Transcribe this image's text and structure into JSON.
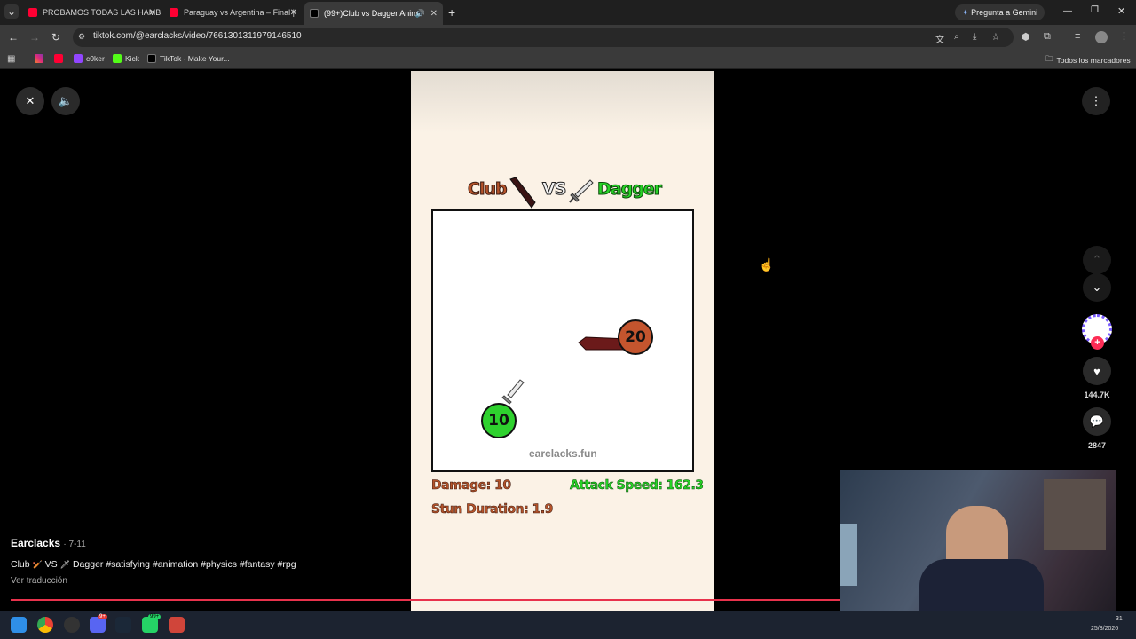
{
  "browser": {
    "tabs": [
      {
        "title": "PROBAMOS TODAS LAS HAMB",
        "favicon": "youtube-icon"
      },
      {
        "title": "Paraguay vs Argentina – Final |",
        "favicon": "youtube-icon"
      },
      {
        "title": "(99+)Club vs Dagger Anim",
        "favicon": "tiktok-icon"
      }
    ],
    "new_tab": "+",
    "gemini": "Pregunta a Gemini",
    "url": "tiktok.com/@earclacks/video/7661301311979146510",
    "bookmarks": [
      {
        "label": "",
        "icon": "instagram-icon"
      },
      {
        "label": "",
        "icon": "youtube-icon"
      },
      {
        "label": "c0ker",
        "icon": "twitch-icon"
      },
      {
        "label": "Kick",
        "icon": "kick-icon"
      },
      {
        "label": "TikTok - Make Your...",
        "icon": "tiktok-icon"
      }
    ],
    "all_bookmarks": "Todos los marcadores"
  },
  "video": {
    "title_left": "Club",
    "vs": "VS",
    "title_right": "Dagger",
    "watermark": "earclacks.fun",
    "ball_dagger_value": "10",
    "ball_club_value": "20",
    "stats": {
      "damage": "Damage: 10",
      "attack_speed": "Attack Speed: 162.3",
      "stun_duration": "Stun Duration: 1.9"
    },
    "colors": {
      "club": "#b4532a",
      "dagger": "#27d427"
    }
  },
  "post": {
    "author": "Earclacks",
    "date": "· 7-11",
    "caption_part1": "Club",
    "caption_part2": "VS",
    "caption_part3": "Dagger #satisfying #animation #physics #fantasy #rpg",
    "translate": "Ver traducción"
  },
  "sidebar": {
    "likes": "144.7K",
    "comments": "2847"
  },
  "taskbar": {
    "clock_fragment": "31",
    "date": "25/8/2026",
    "badge_discord": "9+",
    "badge_whatsapp": "99+"
  }
}
